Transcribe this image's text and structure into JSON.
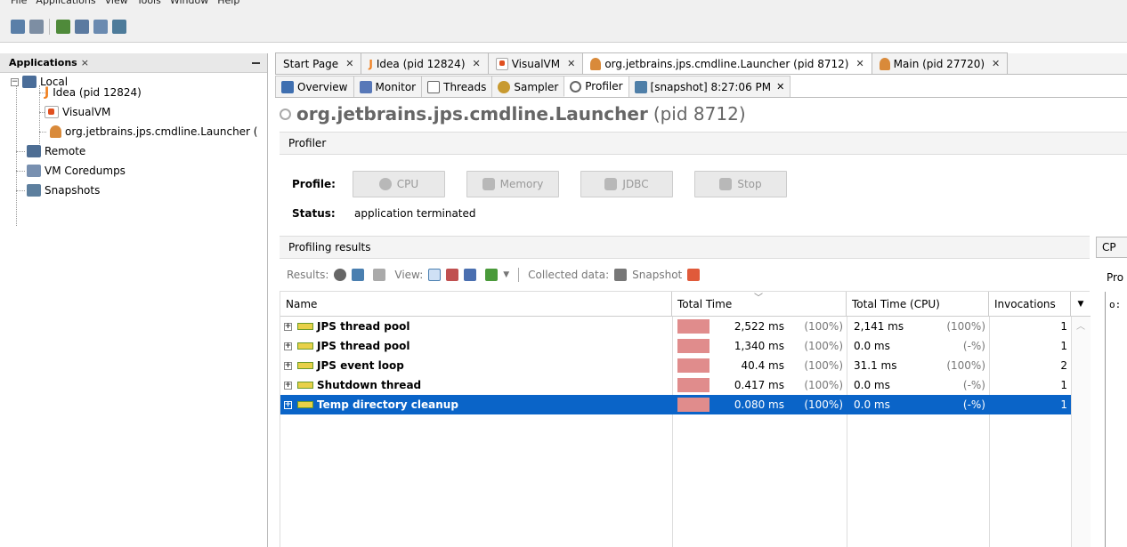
{
  "menu": [
    "File",
    "Applications",
    "View",
    "Tools",
    "Window",
    "Help"
  ],
  "left_panel": {
    "tab_label": "Applications",
    "close": "×",
    "tree": [
      {
        "label": "Local",
        "icon": "computer-icon"
      },
      {
        "label": "Idea (pid 12824)",
        "icon": "intellij-icon"
      },
      {
        "label": "VisualVM",
        "icon": "visualvm-icon"
      },
      {
        "label": "org.jetbrains.jps.cmdline.Launcher (",
        "icon": "java-icon"
      },
      {
        "label": "Remote",
        "icon": "remote-host-icon"
      },
      {
        "label": "VM Coredumps",
        "icon": "coredump-icon"
      },
      {
        "label": "Snapshots",
        "icon": "snapshots-icon"
      }
    ]
  },
  "doc_tabs": [
    {
      "label": "Start Page"
    },
    {
      "label": "Idea (pid 12824)"
    },
    {
      "label": "VisualVM"
    },
    {
      "label": "org.jetbrains.jps.cmdline.Launcher (pid 8712)"
    },
    {
      "label": "Main (pid 27720)"
    }
  ],
  "sub_tabs": [
    {
      "label": "Overview"
    },
    {
      "label": "Monitor"
    },
    {
      "label": "Threads"
    },
    {
      "label": "Sampler"
    },
    {
      "label": "Profiler"
    },
    {
      "label": "[snapshot] 8:27:06 PM"
    }
  ],
  "process": {
    "name": "org.jetbrains.jps.cmdline.Launcher",
    "pid": "(pid 8712)"
  },
  "profiler": {
    "section": "Profiler",
    "profile_label": "Profile:",
    "buttons": [
      "CPU",
      "Memory",
      "JDBC",
      "Stop"
    ],
    "status_label": "Status:",
    "status_value": "application terminated"
  },
  "results": {
    "section": "Profiling results",
    "results_label": "Results:",
    "view_label": "View:",
    "collected_label": "Collected data:",
    "snapshot_label": "Snapshot"
  },
  "table": {
    "columns": [
      "Name",
      "Total Time",
      "Total Time (CPU)",
      "Invocations"
    ],
    "rows": [
      {
        "name": "JPS thread pool",
        "time": "2,522 ms",
        "time_pct": "(100%)",
        "cpu": "2,141 ms",
        "cpu_pct": "(100%)",
        "inv": "1"
      },
      {
        "name": "JPS thread pool",
        "time": "1,340 ms",
        "time_pct": "(100%)",
        "cpu": "0.0 ms",
        "cpu_pct": "(-%)",
        "inv": "1"
      },
      {
        "name": "JPS event loop",
        "time": "40.4 ms",
        "time_pct": "(100%)",
        "cpu": "31.1 ms",
        "cpu_pct": "(100%)",
        "inv": "2"
      },
      {
        "name": "Shutdown thread",
        "time": "0.417 ms",
        "time_pct": "(100%)",
        "cpu": "0.0 ms",
        "cpu_pct": "(-%)",
        "inv": "1"
      },
      {
        "name": "Temp directory cleanup",
        "time": "0.080 ms",
        "time_pct": "(100%)",
        "cpu": "0.0 ms",
        "cpu_pct": "(-%)",
        "inv": "1"
      }
    ],
    "selected_row": 4
  },
  "right_panel": {
    "tab": "CP",
    "label": "Pro",
    "value": "o:"
  },
  "colors": {
    "selection": "#0a64c8",
    "time_bar": "#e08c8c",
    "accent_orange": "#f08020"
  }
}
